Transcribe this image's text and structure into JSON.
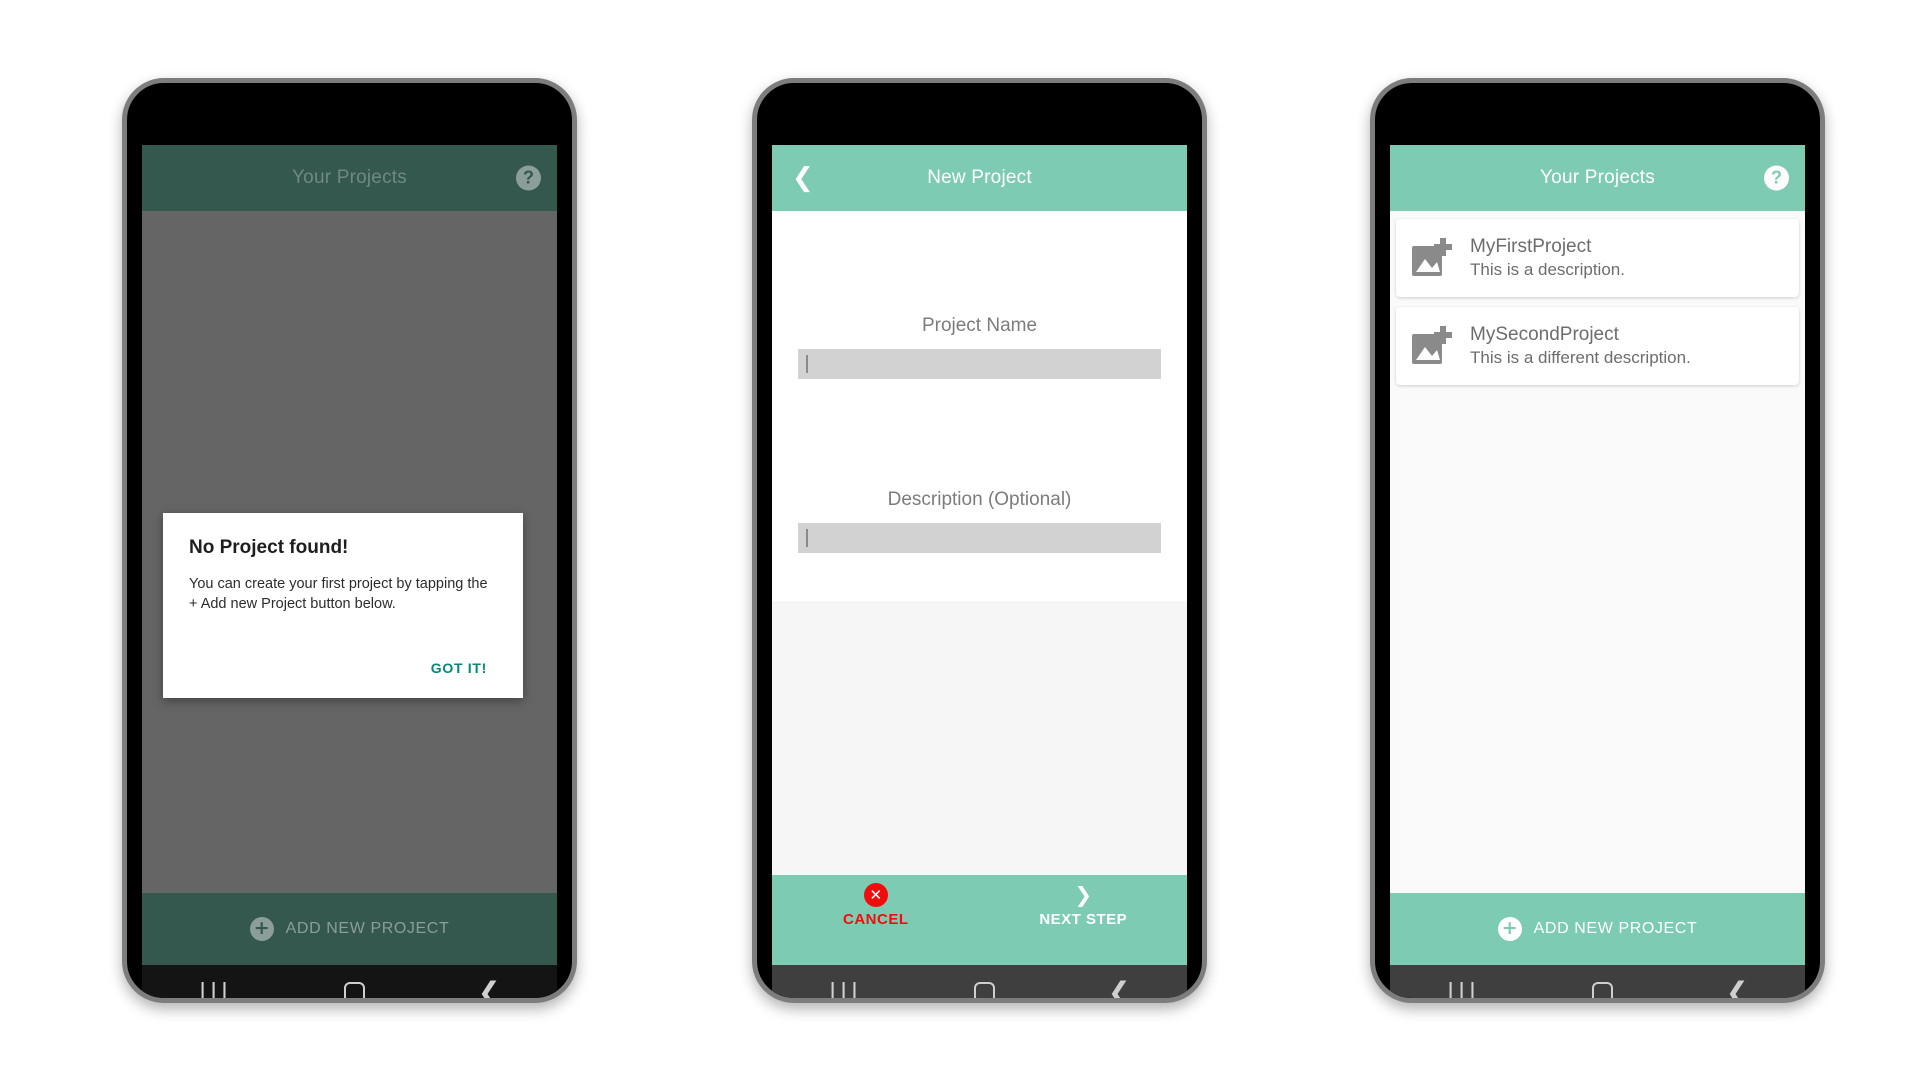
{
  "screens": [
    {
      "id": "no-project-dialog",
      "appbar": {
        "title": "Your Projects",
        "help_icon": "help-circle-icon",
        "dimmed": true
      },
      "dialog": {
        "title": "No Project found!",
        "body": "You can create your first project by tapping the + Add new Project button below.",
        "confirm_label": "GOT IT!",
        "confirm_color": "#00897b"
      },
      "action": {
        "icon": "plus-circle-icon",
        "label": "ADD NEW PROJECT"
      },
      "nav": {
        "recent": "|||",
        "home": "home-square-icon",
        "back": "back-chevron-icon"
      }
    },
    {
      "id": "new-project-form",
      "appbar": {
        "title": "New Project",
        "back_icon": "back-chevron-icon",
        "dimmed": false
      },
      "fields": [
        {
          "label": "Project Name",
          "value": "",
          "placeholder": ""
        },
        {
          "label": "Description (Optional)",
          "value": "",
          "placeholder": ""
        }
      ],
      "actions": [
        {
          "name": "cancel",
          "icon": "close-circle-icon",
          "label": "CANCEL",
          "color": "#f20d0d"
        },
        {
          "name": "next-step",
          "icon": "chevron-right-icon",
          "label": "NEXT STEP",
          "color": "#ffffff"
        }
      ],
      "nav": {
        "recent": "|||",
        "home": "home-square-icon",
        "back": "back-chevron-icon"
      }
    },
    {
      "id": "projects-list",
      "appbar": {
        "title": "Your Projects",
        "help_icon": "help-circle-icon",
        "dimmed": false
      },
      "projects": [
        {
          "icon": "add-photo-icon",
          "title": "MyFirstProject",
          "description": "This is a description."
        },
        {
          "icon": "add-photo-icon",
          "title": "MySecondProject",
          "description": "This is a different description."
        }
      ],
      "action": {
        "icon": "plus-circle-icon",
        "label": "ADD NEW PROJECT"
      },
      "nav": {
        "recent": "|||",
        "home": "home-square-icon",
        "back": "back-chevron-icon"
      }
    }
  ],
  "colors": {
    "accent_teal": "#7ecbb4",
    "dim_teal": "#34574e",
    "scrim_gray": "#656565",
    "danger_red": "#f20d0d",
    "link_teal": "#00897b",
    "nav_gray": "#3f3f3f",
    "field_gray": "#d2d2d2"
  }
}
